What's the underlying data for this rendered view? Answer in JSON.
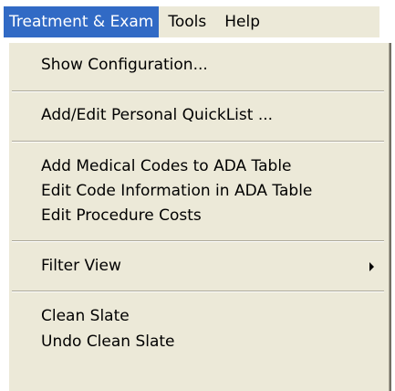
{
  "menubar": {
    "items": [
      {
        "label": "Treatment & Exam",
        "active": true
      },
      {
        "label": "Tools",
        "active": false
      },
      {
        "label": "Help",
        "active": false
      }
    ]
  },
  "dropdown": {
    "items": [
      {
        "label": "Show Configuration..."
      },
      {
        "label": "Add/Edit Personal QuickList ..."
      },
      {
        "label": "Add Medical Codes to ADA Table"
      },
      {
        "label": "Edit Code Information in ADA Table"
      },
      {
        "label": "Edit Procedure Costs"
      },
      {
        "label": "Filter View",
        "has_submenu": true
      },
      {
        "label": "Clean Slate"
      },
      {
        "label": "Undo Clean Slate"
      }
    ]
  },
  "colors": {
    "menu_background": "#ece9d8",
    "highlight": "#316ac5",
    "highlight_text": "#ffffff",
    "separator_dark": "#aca899"
  }
}
